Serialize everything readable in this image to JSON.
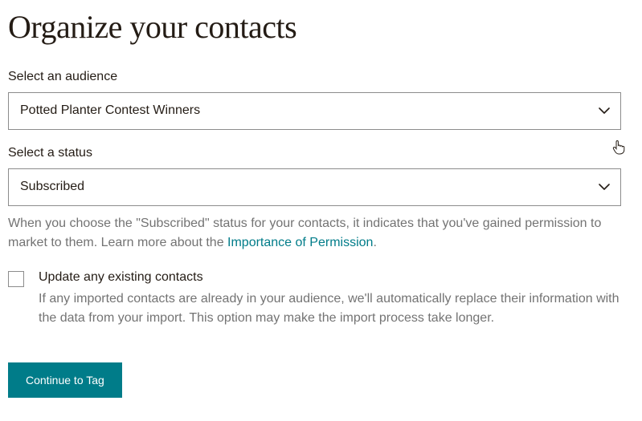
{
  "page": {
    "title": "Organize your contacts"
  },
  "audience": {
    "label": "Select an audience",
    "value": "Potted Planter Contest Winners"
  },
  "status": {
    "label": "Select a status",
    "value": "Subscribed",
    "helper_prefix": "When you choose the \"Subscribed\" status for your contacts, it indicates that you've gained permission to market to them. Learn more about the ",
    "helper_link": "Importance of Permission",
    "helper_suffix": "."
  },
  "update_existing": {
    "label": "Update any existing contacts",
    "description": "If any imported contacts are already in your audience, we'll automatically replace their information with the data from your import. This option may make the import process take longer."
  },
  "actions": {
    "continue_label": "Continue to Tag"
  }
}
